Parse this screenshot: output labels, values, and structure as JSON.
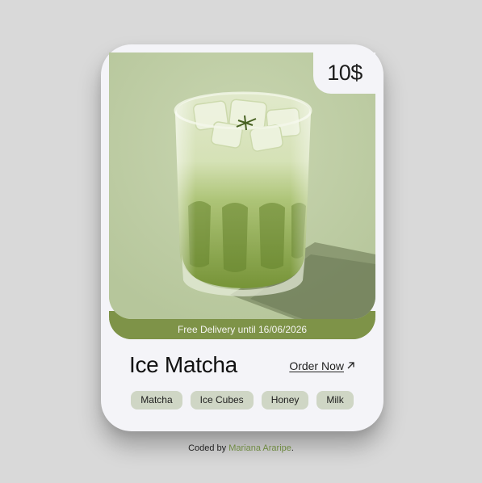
{
  "product": {
    "price": "10$",
    "delivery_note": "Free Delivery until 16/06/2026",
    "name": "Ice Matcha",
    "order_label": "Order Now",
    "order_icon": "arrow-up-right-icon",
    "ingredients": [
      "Matcha",
      "Ice Cubes",
      "Honey",
      "Milk"
    ]
  },
  "footer": {
    "prefix": "Coded by ",
    "author": "Mariana Araripe",
    "suffix": "."
  },
  "colors": {
    "page_bg": "#d9d9d9",
    "card_bg": "#f4f4f8",
    "image_bg": "#bfcda7",
    "accent": "#7e9348",
    "tag_bg": "#cfd6c5",
    "author_link": "#6f8a42"
  }
}
